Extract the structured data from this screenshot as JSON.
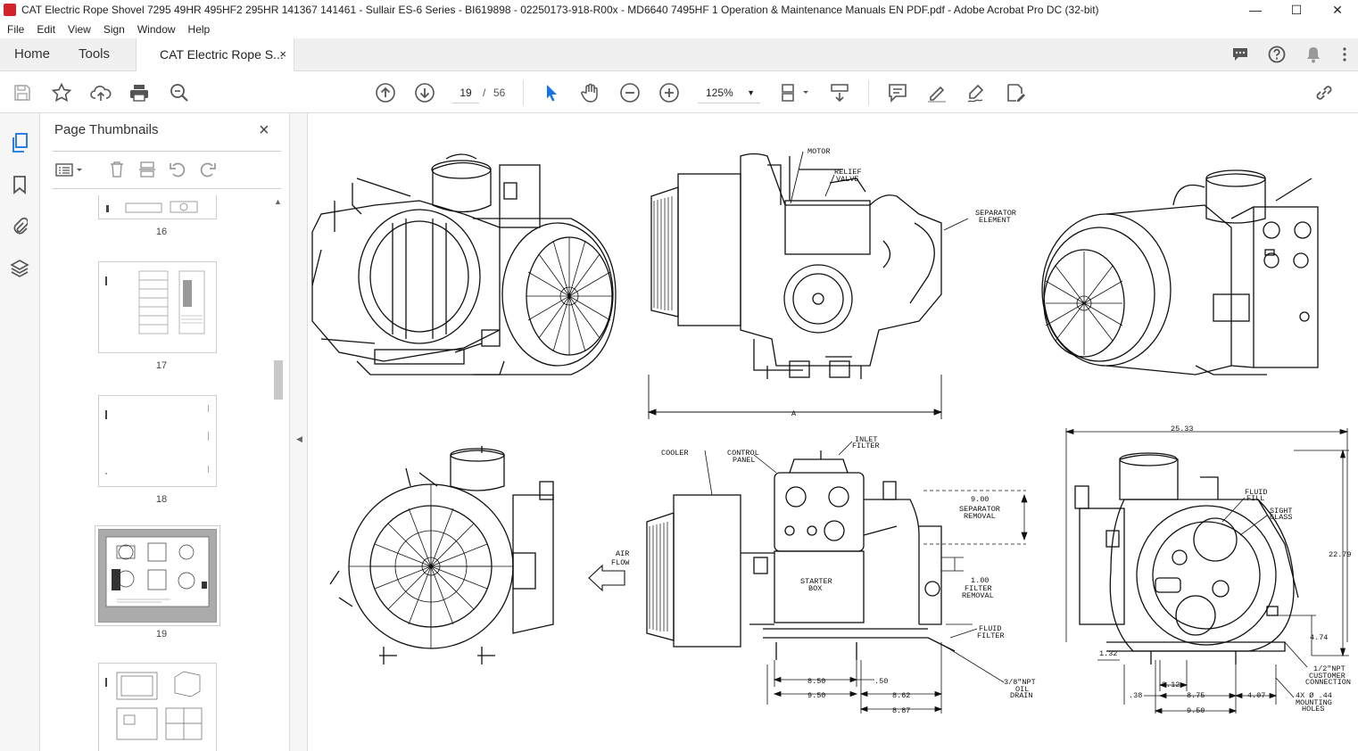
{
  "window": {
    "title": "CAT Electric Rope Shovel 7295 49HR 495HF2 295HR 141367 141461 - Sullair ES-6 Series - BI619898 - 02250173-918-R00x - MD6640 7495HF 1 Operation & Maintenance Manuals EN PDF.pdf - Adobe Acrobat Pro DC (32-bit)",
    "minimize": "—",
    "maximize": "☐",
    "close": "✕"
  },
  "menu": [
    "File",
    "Edit",
    "View",
    "Sign",
    "Window",
    "Help"
  ],
  "tabs": {
    "home": "Home",
    "tools": "Tools",
    "doc": "CAT Electric Rope S...",
    "doc_close": "×"
  },
  "toolbar": {
    "current_page": "19",
    "page_sep": "/",
    "page_count": "56",
    "zoom": "125%"
  },
  "panel": {
    "title": "Page Thumbnails",
    "close": "×",
    "thumbnails": [
      {
        "label": "16"
      },
      {
        "label": "17"
      },
      {
        "label": "18"
      },
      {
        "label": "19"
      },
      {
        "label": ""
      }
    ]
  },
  "drawing": {
    "motor": "MOTOR",
    "relief_valve_1": "RELIEF",
    "relief_valve_2": "VALVE",
    "separator_element_1": "SEPARATOR",
    "separator_element_2": "ELEMENT",
    "dim_a": "A",
    "cooler": "COOLER",
    "control_panel_1": "CONTROL",
    "control_panel_2": "PANEL",
    "inlet_filter_1": "INLET",
    "inlet_filter_2": "FILTER",
    "sep_removal_dim": "9.00",
    "sep_removal_1": "SEPARATOR",
    "sep_removal_2": "REMOVAL",
    "air_flow_1": "AIR",
    "air_flow_2": "FLOW",
    "starter_box_1": "STARTER",
    "starter_box_2": "BOX",
    "filter_removal_dim": "1.00",
    "filter_removal_1": "FILTER",
    "filter_removal_2": "REMOVAL",
    "fluid_filter_1": "FLUID",
    "fluid_filter_2": "FILTER",
    "dim_850": "8.50",
    "dim_050": ".50",
    "dim_950a": "9.50",
    "dim_862": "8.62",
    "dim_887": "8.87",
    "drain_1": "3/8\"NPT",
    "drain_2": "OIL",
    "drain_3": "DRAIN",
    "dim_2533": "25.33",
    "fluid_fill_1": "FLUID",
    "fluid_fill_2": "FILL",
    "sight_glass_1": "SIGHT",
    "sight_glass_2": "GLASS",
    "dim_2279": "22.79",
    "dim_474": "4.74",
    "dim_132": "1.32",
    "dim_312": "3.12",
    "dim_038": ".38",
    "dim_875": "8.75",
    "dim_407": "4.07",
    "dim_950b": "9.50",
    "conn_1": "1/2\"NPT",
    "conn_2": "CUSTOMER",
    "conn_3": "CONNECTION",
    "holes_1": "4X  Ø .44",
    "holes_2": "MOUNTING",
    "holes_3": "HOLES"
  }
}
